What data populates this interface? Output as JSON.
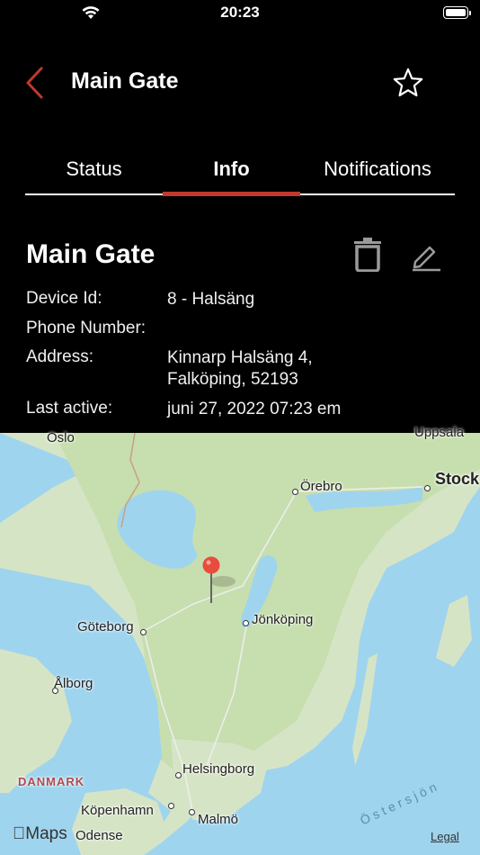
{
  "status_bar": {
    "time": "20:23"
  },
  "nav": {
    "title": "Main Gate"
  },
  "tabs": [
    {
      "label": "Status"
    },
    {
      "label": "Info"
    },
    {
      "label": "Notifications"
    }
  ],
  "accent_color": "#c0392b",
  "device": {
    "title": "Main Gate",
    "fields": [
      {
        "label": "Device Id:",
        "value": "8 - Halsäng"
      },
      {
        "label": "Phone Number:",
        "value": ""
      },
      {
        "label": "Address:",
        "value": "Kinnarp Halsäng 4, Falköping, 52193"
      },
      {
        "label": "Last active:",
        "value": "juni 27, 2022 07:23 em"
      }
    ]
  },
  "map": {
    "places": {
      "oslo": "Oslo",
      "uppsala": "Uppsala",
      "stockholm": "Stock",
      "orebro": "Örebro",
      "goteborg": "Göteborg",
      "jonkoping": "Jönköping",
      "alborg": "Ålborg",
      "danmark": "DANMARK",
      "helsingborg": "Helsingborg",
      "kopenhamn": "Köpenhamn",
      "malmo": "Malmö",
      "odense": "Odense",
      "ostersjon": "Östersjön"
    },
    "logo": "Maps",
    "legal": "Legal"
  }
}
